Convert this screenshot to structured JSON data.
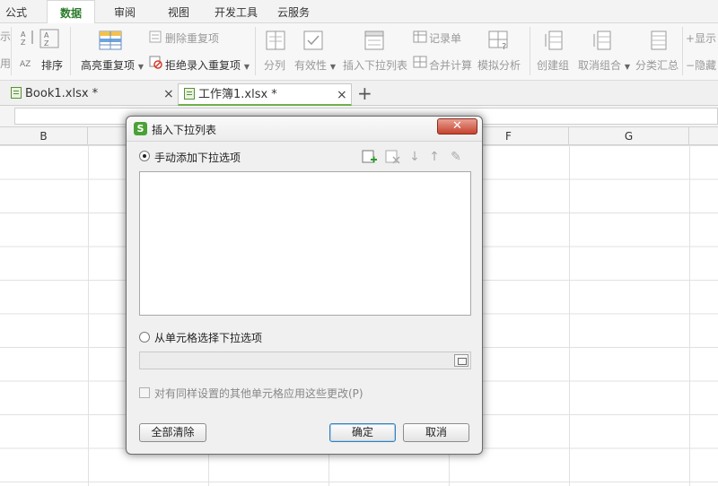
{
  "menu": {
    "tabs": [
      "公式",
      "数据",
      "审阅",
      "视图",
      "开发工具",
      "云服务"
    ],
    "active": "数据"
  },
  "ribbon": {
    "partial_left_top": "示",
    "partial_left_bottom": "用",
    "sort_label": "排序",
    "highlight_dup_label": "高亮重复项",
    "delete_dup_label": "删除重复项",
    "reject_dup_label": "拒绝录入重复项",
    "split_label": "分列",
    "validity_label": "有效性",
    "insert_dropdown_label": "插入下拉列表",
    "record_label": "记录单",
    "merge_calc_label": "合并计算",
    "simulate_label": "模拟分析",
    "create_group_label": "创建组",
    "cancel_group_label": "取消组合",
    "subtotal_label": "分类汇总",
    "show_label": "显示",
    "hide_label": "隐藏"
  },
  "doc_tabs": [
    {
      "label": "Book1.xlsx *",
      "close": "×"
    },
    {
      "label": "工作簿1.xlsx *",
      "close": "×"
    }
  ],
  "doc_add": "+",
  "columns": [
    "B",
    "F",
    "G"
  ],
  "dialog": {
    "title": "插入下拉列表",
    "logo": "S",
    "close": "✕",
    "manual_option": "手动添加下拉选项",
    "cell_option": "从单元格选择下拉选项",
    "apply_checkbox": "对有同样设置的其他单元格应用这些更改(P)",
    "clear_all_button": "全部清除",
    "ok_button": "确定",
    "cancel_button": "取消"
  },
  "colors": {
    "accent_green": "#4aa234",
    "active_tab_text": "#2a7a2a",
    "close_red": "#c7432e"
  }
}
